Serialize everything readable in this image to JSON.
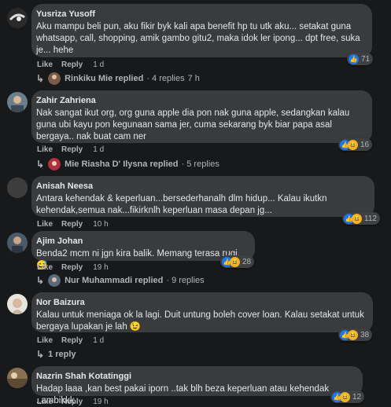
{
  "actions": {
    "like": "Like",
    "reply": "Reply"
  },
  "comments": [
    {
      "name": "Yusriza Yusoff",
      "text": "Aku mampu beli pun, aku fikir byk kali apa benefit hp tu utk aku... setakat guna whatsapp, call, shopping, amik gambo gitu2, maka idok ler ipong... dpt free, suka je... hehe",
      "time": "1 d",
      "reactions": "71",
      "reply_text": "Rinkiku Mie replied",
      "reply_count": "· 4 replies",
      "reply_time": "7 h"
    },
    {
      "name": "Zahir Zahriena",
      "text": "Nak sangat ikut org, org guna apple dia pon nak guna apple, sedangkan kalau guna ubi kayu pon kegunaan sama jer, cuma sekarang byk biar papa asal bergaya.. nak buat cam ner",
      "time": "1 d",
      "reactions": "16",
      "reply_text": "Mie Riasha D' Ilysna replied",
      "reply_count": "· 5 replies"
    },
    {
      "name": "Anisah Neesa",
      "text": "Antara kehendak & keperluan...bersederhanalh dlm hidup... Kalau ikutkn kehendak,semua nak...fikirknlh keperluan masa depan jg...",
      "time": "10 h",
      "reactions": "112"
    },
    {
      "name": "Ajim Johan",
      "text": "Benda2 mcm ni jgn kira balik. Memang terasa rugi. 😅",
      "time": "19 h",
      "reactions": "28",
      "reply_text": "Nur Muhammadi replied",
      "reply_count": "· 9 replies"
    },
    {
      "name": "Nor Baizura",
      "text": "Kalau untuk meniaga ok la lagi. Duit untung boleh cover loan. Kalau setakat untuk bergaya lupakan je lah 😉",
      "time": "1 d",
      "reactions": "38",
      "reply_text": "1 reply"
    },
    {
      "name": "Nazrin Shah Kotatinggi",
      "text": "Hadap laaa ,kan best pakai iporn ..tak blh beza keperluan atau kehendak ..ambikkk",
      "time": "19 h",
      "reactions": "12"
    }
  ],
  "colors": {
    "background": "#18191a",
    "bubble": "#3a3b3c",
    "like_blue": "#1877f2",
    "haha_yellow": "#f7b125",
    "muted": "#b0b3b8"
  }
}
